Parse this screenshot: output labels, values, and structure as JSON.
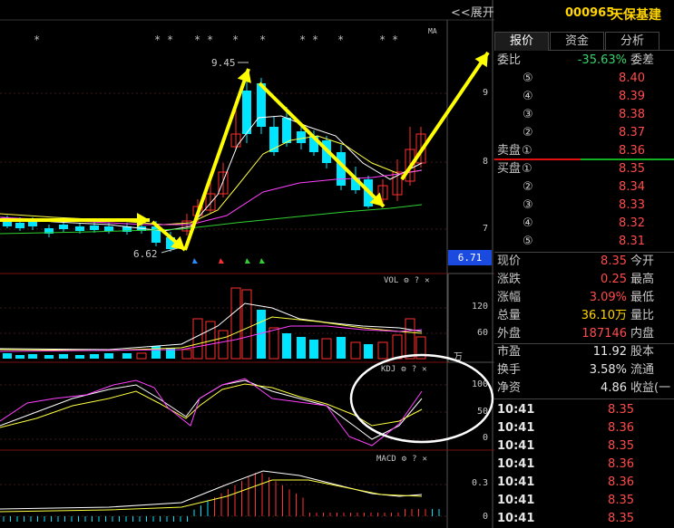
{
  "toolbar": {
    "expand_label": "<<展开"
  },
  "chart_header": {
    "ma_label": "MA",
    "stars": [
      "*",
      "*",
      "*",
      "*",
      "*",
      "*",
      "*",
      "*",
      "*",
      "*",
      "*",
      "*",
      "*",
      "*"
    ]
  },
  "price_annotations": {
    "high": "9.45",
    "low": "6.62"
  },
  "current_price_tag": "6.71",
  "price_axis": [
    "9",
    "8",
    "7"
  ],
  "vol_panel": {
    "title": "VOL",
    "axis": [
      "120",
      "60"
    ],
    "unit": "万"
  },
  "kdj_panel": {
    "title": "KDJ",
    "axis": [
      "100",
      "50",
      "0"
    ]
  },
  "macd_panel": {
    "title": "MACD",
    "axis": [
      "0.3",
      "0"
    ]
  },
  "panel_icons": {
    "settings": "⚙",
    "help": "?",
    "close": "✕"
  },
  "colors": {
    "up": "#ff3030",
    "down": "#00e5ff",
    "ma5": "#ffffff",
    "ma10": "#ffff40",
    "ma20": "#ff40ff",
    "ma60": "#30d030",
    "arrow": "#ffff00",
    "accent_blue": "#1a4ae0"
  },
  "stock": {
    "code": "000965",
    "name": "天保基建"
  },
  "tabs": [
    {
      "label": "报价",
      "active": true
    },
    {
      "label": "资金",
      "active": false
    },
    {
      "label": "分析",
      "active": false
    }
  ],
  "order_book": {
    "ratio_label": "委比",
    "ratio_value": "-35.63%",
    "diff_label": "委差",
    "sell_label": "卖盘",
    "buy_label": "买盘",
    "sell": [
      {
        "level": "⑤",
        "price": "8.40"
      },
      {
        "level": "④",
        "price": "8.39"
      },
      {
        "level": "③",
        "price": "8.38"
      },
      {
        "level": "②",
        "price": "8.37"
      },
      {
        "level": "①",
        "price": "8.36"
      }
    ],
    "buy": [
      {
        "level": "①",
        "price": "8.35"
      },
      {
        "level": "②",
        "price": "8.34"
      },
      {
        "level": "③",
        "price": "8.33"
      },
      {
        "level": "④",
        "price": "8.32"
      },
      {
        "level": "⑤",
        "price": "8.31"
      }
    ]
  },
  "quote": [
    {
      "label": "现价",
      "value": "8.35",
      "color": "red",
      "label2": "今开"
    },
    {
      "label": "涨跌",
      "value": "0.25",
      "color": "red",
      "label2": "最高"
    },
    {
      "label": "涨幅",
      "value": "3.09%",
      "color": "red",
      "label2": "最低"
    },
    {
      "label": "总量",
      "value": "36.10万",
      "color": "yellow",
      "label2": "量比"
    },
    {
      "label": "外盘",
      "value": "187146",
      "color": "red",
      "label2": "内盘"
    }
  ],
  "fundamentals": [
    {
      "label": "市盈",
      "value": "11.92",
      "label2": "股本"
    },
    {
      "label": "换手",
      "value": "3.58%",
      "label2": "流通"
    },
    {
      "label": "净资",
      "value": "4.86",
      "label2": "收益(一"
    }
  ],
  "ticks": [
    {
      "time": "10:41",
      "price": "8.35"
    },
    {
      "time": "10:41",
      "price": "8.36"
    },
    {
      "time": "10:41",
      "price": "8.35"
    },
    {
      "time": "10:41",
      "price": "8.36"
    },
    {
      "time": "10:41",
      "price": "8.36"
    },
    {
      "time": "10:41",
      "price": "8.35"
    },
    {
      "time": "10:41",
      "price": "8.35"
    }
  ]
}
